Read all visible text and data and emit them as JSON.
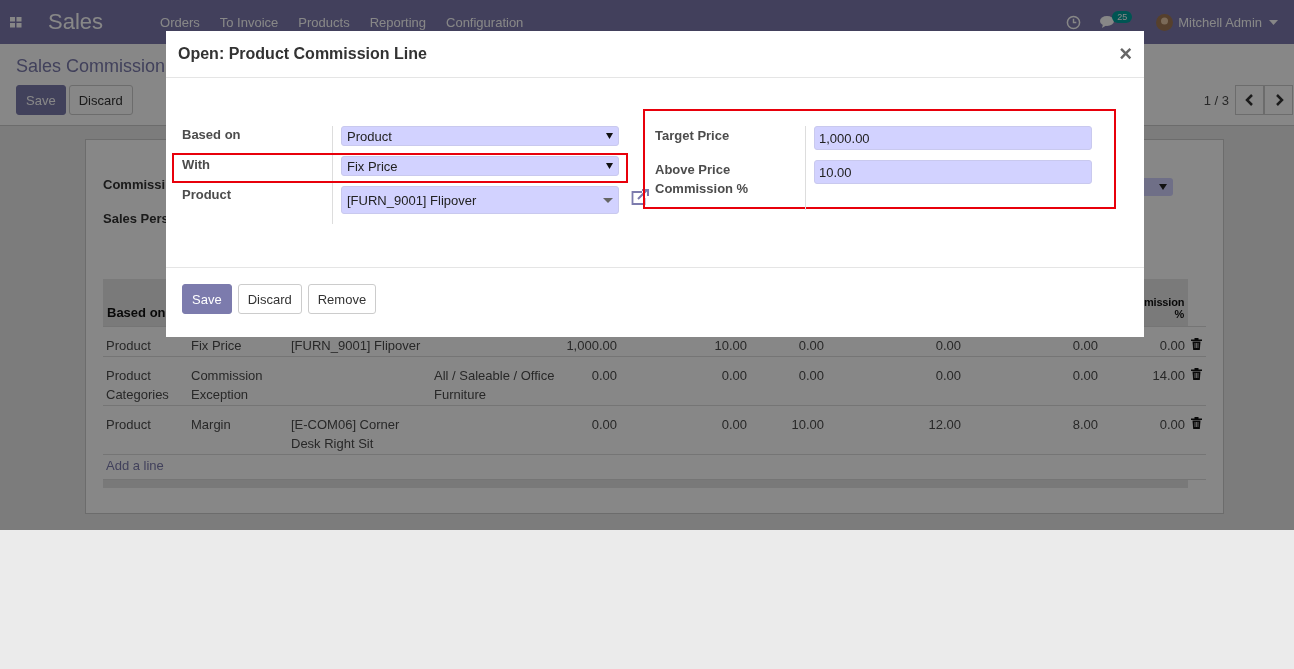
{
  "navbar": {
    "app_title": "Sales",
    "menu": [
      "Orders",
      "To Invoice",
      "Products",
      "Reporting",
      "Configuration"
    ],
    "message_count": "25",
    "user": "Mitchell Admin"
  },
  "control_panel": {
    "title": "Sales Commission",
    "buttons": [
      {
        "label": "Save",
        "primary": true
      },
      {
        "label": "Discard",
        "primary": false
      }
    ],
    "pager": "1 / 3"
  },
  "form": {
    "labels": [
      "Commissi",
      "Sales Pers"
    ],
    "table": {
      "header_first": "Based on",
      "header_last": "mission %",
      "rows": [
        {
          "cells": [
            "Product",
            "Fix Price",
            "[FURN_9001] Flipover",
            "",
            "1,000.00",
            "10.00",
            "0.00",
            "0.00",
            "0.00",
            "0.00"
          ]
        },
        {
          "cells": [
            "Product Categories",
            "Commission Exception",
            "",
            "All / Saleable / Office Furniture",
            "0.00",
            "0.00",
            "0.00",
            "0.00",
            "0.00",
            "14.00"
          ]
        },
        {
          "cells": [
            "Product",
            "Margin",
            "[E-COM06] Corner Desk Right Sit",
            "",
            "0.00",
            "0.00",
            "10.00",
            "12.00",
            "8.00",
            "0.00"
          ]
        }
      ],
      "add_line": "Add a line"
    }
  },
  "dialog": {
    "title": "Open: Product Commission Line",
    "close": "×",
    "left_fields": [
      {
        "label": "Based on",
        "value": "Product",
        "kind": "select",
        "highlighted": false
      },
      {
        "label": "With",
        "value": "Fix Price",
        "kind": "select",
        "highlighted": true
      },
      {
        "label": "Product",
        "value": "[FURN_9001] Flipover",
        "kind": "many2one",
        "highlighted": false
      }
    ],
    "right_highlighted": true,
    "right_fields": [
      {
        "label": "Target Price",
        "value": "1,000.00"
      },
      {
        "label": "Above Price Commission %",
        "value": "10.00"
      }
    ],
    "buttons": [
      {
        "label": "Save",
        "primary": true
      },
      {
        "label": "Discard",
        "primary": false
      },
      {
        "label": "Remove",
        "primary": false
      }
    ]
  }
}
